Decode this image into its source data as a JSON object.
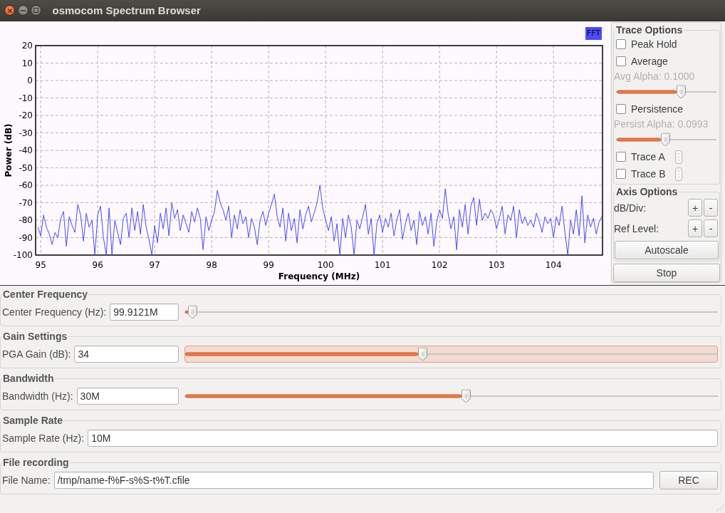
{
  "window": {
    "title": "osmocom Spectrum Browser"
  },
  "spectrum": {
    "chart_data": [
      {
        "type": "line",
        "xlabel": "Frequency (MHz)",
        "ylabel": "Power (dB)",
        "xlim": [
          94.91,
          104.86
        ],
        "ylim": [
          -100,
          20
        ],
        "xticks": [
          95,
          96,
          97,
          98,
          99,
          100,
          101,
          102,
          103,
          104
        ],
        "yticks": [
          20,
          10,
          0,
          -10,
          -20,
          -30,
          -40,
          -50,
          -60,
          -70,
          -80,
          -90,
          -100
        ],
        "grid": true,
        "legend": "upper right",
        "x": [
          94.95,
          95,
          95.05,
          95.1,
          95.15,
          95.2,
          95.25,
          95.3,
          95.35,
          95.4,
          95.45,
          95.5,
          95.55,
          95.6,
          95.65,
          95.7,
          95.75,
          95.8,
          95.85,
          95.9,
          95.95,
          96,
          96.05,
          96.1,
          96.15,
          96.2,
          96.25,
          96.3,
          96.35,
          96.4,
          96.45,
          96.5,
          96.55,
          96.6,
          96.65,
          96.7,
          96.75,
          96.8,
          96.85,
          96.9,
          96.95,
          97,
          97.05,
          97.1,
          97.15,
          97.2,
          97.25,
          97.3,
          97.35,
          97.4,
          97.45,
          97.5,
          97.55,
          97.6,
          97.65,
          97.7,
          97.75,
          97.8,
          97.85,
          97.9,
          97.95,
          98,
          98.05,
          98.1,
          98.15,
          98.2,
          98.25,
          98.3,
          98.35,
          98.4,
          98.45,
          98.5,
          98.55,
          98.6,
          98.65,
          98.7,
          98.75,
          98.8,
          98.85,
          98.9,
          98.95,
          99,
          99.05,
          99.1,
          99.15,
          99.2,
          99.25,
          99.3,
          99.35,
          99.4,
          99.45,
          99.5,
          99.55,
          99.6,
          99.65,
          99.7,
          99.75,
          99.8,
          99.85,
          99.9,
          99.95,
          100,
          100.05,
          100.1,
          100.15,
          100.2,
          100.25,
          100.3,
          100.35,
          100.4,
          100.45,
          100.5,
          100.55,
          100.6,
          100.65,
          100.7,
          100.75,
          100.8,
          100.85,
          100.9,
          100.95,
          101,
          101.05,
          101.1,
          101.15,
          101.2,
          101.25,
          101.3,
          101.35,
          101.4,
          101.45,
          101.5,
          101.55,
          101.6,
          101.65,
          101.7,
          101.75,
          101.8,
          101.85,
          101.9,
          101.95,
          102,
          102.05,
          102.1,
          102.15,
          102.2,
          102.25,
          102.3,
          102.35,
          102.4,
          102.45,
          102.5,
          102.55,
          102.6,
          102.65,
          102.7,
          102.75,
          102.8,
          102.85,
          102.9,
          102.95,
          103,
          103.05,
          103.1,
          103.15,
          103.2,
          103.25,
          103.3,
          103.35,
          103.4,
          103.45,
          103.5,
          103.55,
          103.6,
          103.65,
          103.7,
          103.75,
          103.8,
          103.85,
          103.9,
          103.95,
          104,
          104.05,
          104.1,
          104.15,
          104.2,
          104.25,
          104.3,
          104.35,
          104.4,
          104.45,
          104.5,
          104.55,
          104.6,
          104.65,
          104.7,
          104.75,
          104.8,
          104.85
        ],
        "series": [
          {
            "name": "FFT",
            "color": "#4a4aff",
            "values": [
              -84,
              -89,
              -77,
              -84,
              -88,
              -94,
              -87,
              -90,
              -79,
              -75,
              -95,
              -78,
              -83,
              -87,
              -71,
              -77,
              -92,
              -76,
              -84,
              -80,
              -100,
              -77,
              -72,
              -90,
              -100,
              -73,
              -100,
              -80,
              -87,
              -94,
              -79,
              -76,
              -90,
              -73,
              -86,
              -75,
              -88,
              -71,
              -84,
              -91,
              -100,
              -83,
              -93,
              -76,
              -85,
              -73,
              -89,
              -70,
              -79,
              -74,
              -86,
              -77,
              -82,
              -87,
              -75,
              -81,
              -73,
              -79,
              -97,
              -78,
              -86,
              -80,
              -75,
              -63,
              -70,
              -74,
              -80,
              -72,
              -90,
              -77,
              -85,
              -74,
              -82,
              -78,
              -90,
              -79,
              -84,
              -94,
              -80,
              -75,
              -83,
              -76,
              -71,
              -65,
              -78,
              -84,
              -73,
              -92,
              -76,
              -86,
              -79,
              -93,
              -74,
              -85,
              -77,
              -72,
              -81,
              -76,
              -70,
              -60,
              -73,
              -80,
              -86,
              -78,
              -92,
              -82,
              -100,
              -79,
              -90,
              -77,
              -84,
              -100,
              -80,
              -85,
              -78,
              -71,
              -88,
              -79,
              -100,
              -82,
              -77,
              -87,
              -79,
              -84,
              -76,
              -89,
              -80,
              -74,
              -91,
              -82,
              -76,
              -86,
              -80,
              -94,
              -75,
              -83,
              -78,
              -88,
              -76,
              -95,
              -81,
              -74,
              -79,
              -62,
              -76,
              -85,
              -78,
              -97,
              -74,
              -84,
              -71,
              -88,
              -72,
              -67,
              -83,
              -68,
              -80,
              -76,
              -79,
              -74,
              -77,
              -85,
              -79,
              -72,
              -88,
              -77,
              -80,
              -72,
              -90,
              -74,
              -82,
              -78,
              -83,
              -80,
              -84,
              -76,
              -81,
              -87,
              -78,
              -82,
              -79,
              -90,
              -78,
              -83,
              -72,
              -87,
              -100,
              -80,
              -88,
              -74,
              -89,
              -66,
              -93,
              -77,
              -84,
              -79,
              -88,
              -81,
              -78
            ]
          }
        ]
      }
    ]
  },
  "side_panel": {
    "trace_options": {
      "title": "Trace Options",
      "items": [
        {
          "kind": "checkbox",
          "label": "Peak Hold",
          "checked": false
        },
        {
          "kind": "checkbox",
          "label": "Average",
          "checked": false
        },
        {
          "kind": "alpha",
          "label": "Avg Alpha: 0.1000",
          "disabled": true,
          "level": 0.65
        },
        {
          "kind": "checkbox",
          "label": "Persistence",
          "checked": false
        },
        {
          "kind": "alpha",
          "label": "Persist Alpha: 0.0993",
          "disabled": true,
          "level": 0.49
        },
        {
          "kind": "trace",
          "label": "Trace A",
          "checked": false
        },
        {
          "kind": "trace",
          "label": "Trace B",
          "checked": false
        }
      ]
    },
    "axis_options": {
      "title": "Axis Options",
      "rows": [
        {
          "label": "dB/Div:",
          "buttons": [
            "+",
            "-"
          ]
        },
        {
          "label": "Ref Level:",
          "buttons": [
            "+",
            "-"
          ]
        }
      ],
      "autoscale": "Autoscale"
    },
    "stop": "Stop"
  },
  "controls": [
    {
      "kind": "slider",
      "title": "Center Frequency",
      "label": "Center Frequency (Hz):",
      "value": "99.9121M",
      "level": 0.014,
      "focused": false
    },
    {
      "kind": "slider",
      "title": "Gain Settings",
      "label": "PGA Gain (dB):",
      "value": "34",
      "level": 0.446,
      "focused": true
    },
    {
      "kind": "slider",
      "title": "Bandwidth",
      "label": "Bandwidth (Hz):",
      "value": "30M",
      "level": 0.528,
      "focused": false
    },
    {
      "kind": "entry",
      "title": "Sample Rate",
      "label": "Sample Rate (Hz):",
      "value": "10M"
    },
    {
      "kind": "record",
      "title": "File recording",
      "label": "File Name:",
      "value": "/tmp/name-f%F-s%S-t%T.cfile",
      "button": "REC"
    }
  ]
}
